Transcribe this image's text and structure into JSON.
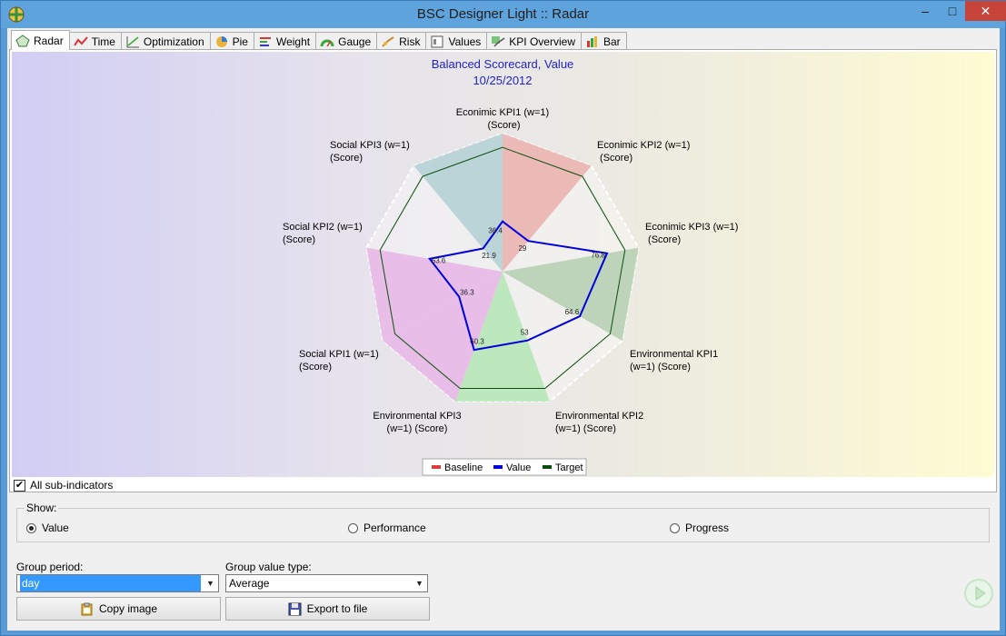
{
  "window": {
    "title": "BSC Designer Light :: Radar",
    "minimize_icon": "minimize-icon",
    "maximize_icon": "maximize-icon",
    "close_icon": "close-icon"
  },
  "tabs": [
    {
      "label": "Radar",
      "icon": "radar-icon",
      "active": true
    },
    {
      "label": "Time",
      "icon": "time-chart-icon",
      "active": false
    },
    {
      "label": "Optimization",
      "icon": "optimization-icon",
      "active": false
    },
    {
      "label": "Pie",
      "icon": "pie-chart-icon",
      "active": false
    },
    {
      "label": "Weight",
      "icon": "weight-icon",
      "active": false
    },
    {
      "label": "Gauge",
      "icon": "gauge-icon",
      "active": false
    },
    {
      "label": "Risk",
      "icon": "risk-icon",
      "active": false
    },
    {
      "label": "Values",
      "icon": "values-icon",
      "active": false
    },
    {
      "label": "KPI Overview",
      "icon": "kpi-overview-icon",
      "active": false
    },
    {
      "label": "Bar",
      "icon": "bar-chart-icon",
      "active": false
    }
  ],
  "chart_data": {
    "type": "radar",
    "title": "Balanced Scorecard, Value",
    "subtitle": "10/25/2012",
    "categories": [
      "Econimic KPI1 (w=1) (Score)",
      "Econimic KPI2 (w=1) (Score)",
      "Econimic KPI3 (w=1) (Score)",
      "Environmental KPI1 (w=1) (Score)",
      "Environmental KPI2 (w=1) (Score)",
      "Environmental KPI3 (w=1) (Score)",
      "Social KPI1 (w=1) (Score)",
      "Social KPI2 (w=1) (Score)",
      "Social KPI3 (w=1) (Score)"
    ],
    "label_lines": [
      [
        "Econimic KPI1 (w=1)",
        " (Score)"
      ],
      [
        "Econimic KPI2 (w=1)",
        " (Score)"
      ],
      [
        "Econimic KPI3 (w=1)",
        " (Score)"
      ],
      [
        "Environmental KPI1",
        "(w=1) (Score)"
      ],
      [
        "Environmental KPI2",
        "(w=1) (Score)"
      ],
      [
        "Environmental KPI3",
        "(w=1) (Score)"
      ],
      [
        "Social KPI1 (w=1)",
        "(Score)"
      ],
      [
        "Social KPI2 (w=1)",
        "(Score)"
      ],
      [
        "Social KPI3 (w=1)",
        "(Score)"
      ]
    ],
    "series": [
      {
        "name": "Baseline",
        "color": "#e03c3c",
        "values": [
          100,
          100,
          100,
          100,
          100,
          100,
          100,
          100,
          100
        ]
      },
      {
        "name": "Value",
        "color": "#0000dd",
        "values": [
          36.4,
          29,
          76.8,
          64.6,
          53,
          60.3,
          36.3,
          53.6,
          21.9
        ]
      },
      {
        "name": "Target",
        "color": "#0b4d0b",
        "values": [
          90,
          90,
          90,
          90,
          90,
          90,
          90,
          90,
          90
        ]
      }
    ],
    "value_labels": [
      "36.4",
      "29",
      "76.8",
      "64.6",
      "53",
      "60.3",
      "36.3",
      "53.6",
      "21.9"
    ],
    "sector_colors": [
      "#eab0ad",
      "#eab0ad",
      "#b4cfb1",
      "#b4b4e6",
      "#b4e6b4",
      "#e6b4e6",
      "#e6b4e6",
      "#b1cfd4",
      "#b1cfd4"
    ],
    "sector_fill_values": [
      100,
      100,
      100,
      100,
      100,
      100,
      100,
      100,
      100
    ],
    "rlim": [
      0,
      100
    ],
    "legend_position": "bottom-center",
    "title_color": "#1f1fc7"
  },
  "controls": {
    "all_subindicators_label": "All sub-indicators",
    "all_subindicators_checked": true,
    "show_label": "Show:",
    "show_options": [
      {
        "label": "Value",
        "selected": true
      },
      {
        "label": "Performance",
        "selected": false
      },
      {
        "label": "Progress",
        "selected": false
      }
    ],
    "group_period_label": "Group period:",
    "group_period_value": "day",
    "group_value_type_label": "Group value type:",
    "group_value_type_value": "Average",
    "copy_image_label": "Copy image",
    "copy_image_icon": "clipboard-icon",
    "export_label": "Export to file",
    "export_icon": "floppy-disk-icon",
    "play_icon": "play-icon"
  }
}
